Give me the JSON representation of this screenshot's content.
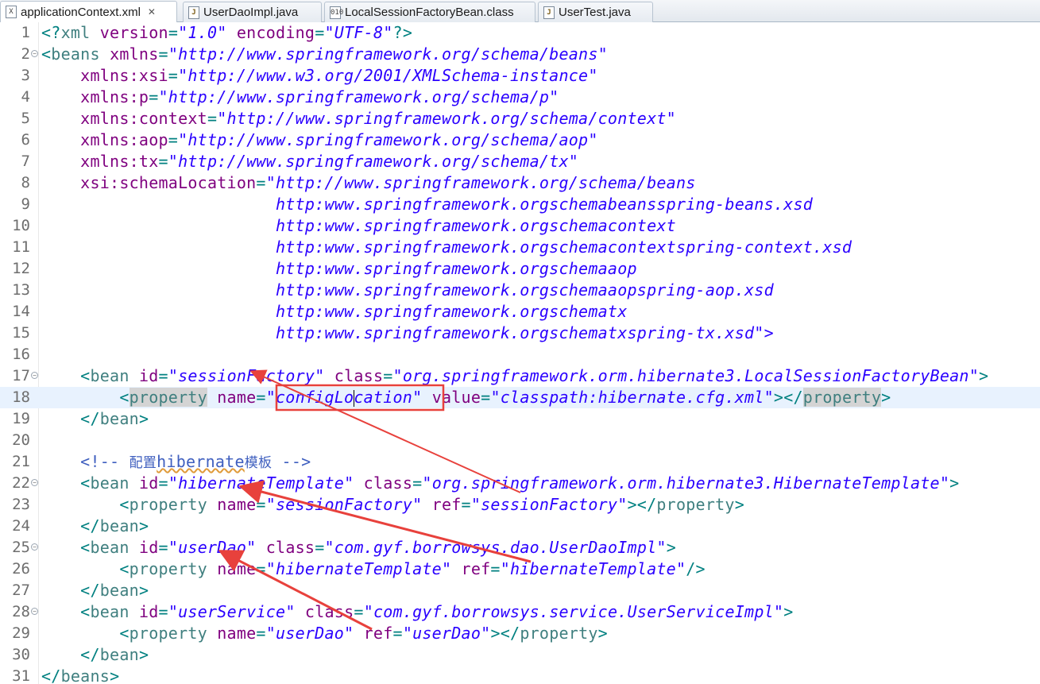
{
  "tabs": [
    {
      "label": "applicationContext.xml",
      "icon": "xml-file-icon",
      "active": true,
      "closable": true
    },
    {
      "label": "UserDaoImpl.java",
      "icon": "java-file-icon"
    },
    {
      "label": "LocalSessionFactoryBean.class",
      "icon": "class-file-icon"
    },
    {
      "label": "UserTest.java",
      "icon": "java-file-icon"
    }
  ],
  "editor": {
    "current_line": 18,
    "highlighted_value": "\"configLocation\"",
    "lines": [
      {
        "n": "1",
        "text": "<?xml version=\"1.0\" encoding=\"UTF-8\"?>"
      },
      {
        "n": "2",
        "text": "<beans xmlns=\"http://www.springframework.org/schema/beans\""
      },
      {
        "n": "3",
        "text": "    xmlns:xsi=\"http://www.w3.org/2001/XMLSchema-instance\""
      },
      {
        "n": "4",
        "text": "    xmlns:p=\"http://www.springframework.org/schema/p\""
      },
      {
        "n": "5",
        "text": "    xmlns:context=\"http://www.springframework.org/schema/context\""
      },
      {
        "n": "6",
        "text": "    xmlns:aop=\"http://www.springframework.org/schema/aop\""
      },
      {
        "n": "7",
        "text": "    xmlns:tx=\"http://www.springframework.org/schema/tx\""
      },
      {
        "n": "8",
        "text": "    xsi:schemaLocation=\"http://www.springframework.org/schema/beans"
      },
      {
        "n": "9",
        "text": "                        http://www.springframework.org/schema/beans/spring-beans.xsd"
      },
      {
        "n": "10",
        "text": "                        http://www.springframework.org/schema/context"
      },
      {
        "n": "11",
        "text": "                        http://www.springframework.org/schema/context/spring-context.xsd"
      },
      {
        "n": "12",
        "text": "                        http://www.springframework.org/schema/aop"
      },
      {
        "n": "13",
        "text": "                        http://www.springframework.org/schema/aop/spring-aop.xsd"
      },
      {
        "n": "14",
        "text": "                        http://www.springframework.org/schema/tx"
      },
      {
        "n": "15",
        "text": "                        http://www.springframework.org/schema/tx/spring-tx.xsd\">"
      },
      {
        "n": "16",
        "text": ""
      },
      {
        "n": "17",
        "text": "    <bean id=\"sessionFactory\" class=\"org.springframework.orm.hibernate3.LocalSessionFactoryBean\">"
      },
      {
        "n": "18",
        "text": "        <property name=\"configLocation\" value=\"classpath:hibernate.cfg.xml\"></property>"
      },
      {
        "n": "19",
        "text": "    </bean>"
      },
      {
        "n": "20",
        "text": ""
      },
      {
        "n": "21",
        "text": "    <!-- 配置hibernate模板 -->"
      },
      {
        "n": "22",
        "text": "    <bean id=\"hibernateTemplate\" class=\"org.springframework.orm.hibernate3.HibernateTemplate\">"
      },
      {
        "n": "23",
        "text": "        <property name=\"sessionFactory\" ref=\"sessionFactory\"></property>"
      },
      {
        "n": "24",
        "text": "    </bean>"
      },
      {
        "n": "25",
        "text": "    <bean id=\"userDao\" class=\"com.gyf.borrowsys.dao.UserDaoImpl\">"
      },
      {
        "n": "26",
        "text": "        <property name=\"hibernateTemplate\" ref=\"hibernateTemplate\"/>"
      },
      {
        "n": "27",
        "text": "    </bean>"
      },
      {
        "n": "28",
        "text": "    <bean id=\"userService\" class=\"com.gyf.borrowsys.service.UserServiceImpl\">"
      },
      {
        "n": "29",
        "text": "        <property name=\"userDao\" ref=\"userDao\"></property>"
      },
      {
        "n": "30",
        "text": "    </bean>"
      },
      {
        "n": "31",
        "text": "</beans>"
      }
    ]
  },
  "colors": {
    "tag": "#3f7f7f",
    "attribute": "#7f007f",
    "string": "#2a00ff",
    "comment": "#3f5fbf",
    "annotation": "#e8413c",
    "current_line": "#e8f2fe"
  }
}
